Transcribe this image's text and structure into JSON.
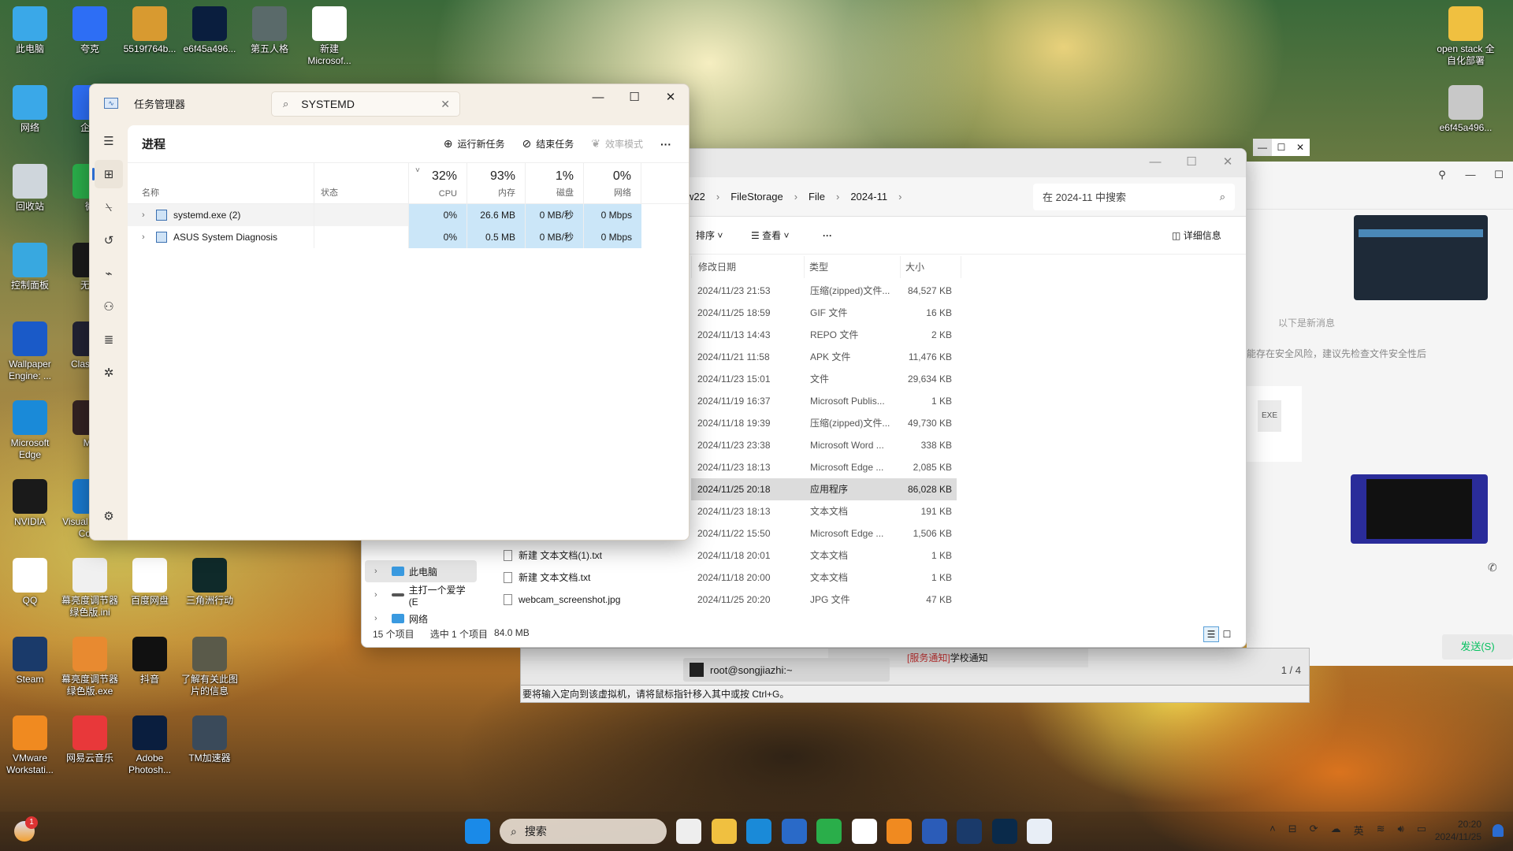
{
  "desktop": {
    "icons": [
      {
        "label": "此电脑",
        "icon": "computer-icon",
        "color": "#3aa8e8"
      },
      {
        "label": "夸克",
        "icon": "quark-icon",
        "color": "#2d6ef5"
      },
      {
        "label": "5519f764b...",
        "icon": "image-file-icon",
        "color": "#d89a30"
      },
      {
        "label": "e6f45a496...",
        "icon": "psd-file-icon",
        "color": "#0a1e3e"
      },
      {
        "label": "第五人格",
        "icon": "game-icon",
        "color": "#5a6a6a"
      },
      {
        "label": "新建 Microsof...",
        "icon": "word-doc-icon",
        "color": "#ffffff"
      },
      {
        "label": "网络",
        "icon": "network-icon",
        "color": "#3aa8e8"
      },
      {
        "label": "企业",
        "icon": "enterprise-icon",
        "color": "#2d6ef5"
      },
      {
        "label": "回收站",
        "icon": "recycle-bin-icon",
        "color": "#cfd6dc"
      },
      {
        "label": "微",
        "icon": "wechat-icon",
        "color": "#2aae4a"
      },
      {
        "label": "控制面板",
        "icon": "control-panel-icon",
        "color": "#38a8e0"
      },
      {
        "label": "无畏",
        "icon": "valorant-icon",
        "color": "#1a1a1a"
      },
      {
        "label": "Wallpaper Engine: ...",
        "icon": "wallpaper-engine-icon",
        "color": "#1a5ac8"
      },
      {
        "label": "Clas Win",
        "icon": "classic-icon",
        "color": "#223"
      },
      {
        "label": "Microsoft Edge",
        "icon": "edge-icon",
        "color": "#1a8ad8"
      },
      {
        "label": "Me",
        "icon": "me-icon",
        "color": "#322"
      },
      {
        "label": "NVIDIA",
        "icon": "nvidia-icon",
        "color": "#1a1a1a"
      },
      {
        "label": "Visual Studio Code",
        "icon": "vscode-icon",
        "color": "#1a7ad0"
      },
      {
        "label": "QQ",
        "icon": "qq-icon",
        "color": "#ffffff"
      },
      {
        "label": "幕亮度调节器绿色版.ini",
        "icon": "ini-file-icon",
        "color": "#f0f0f0"
      },
      {
        "label": "百度网盘",
        "icon": "baidu-netdisk-icon",
        "color": "#ffffff"
      },
      {
        "label": "三角洲行动",
        "icon": "delta-force-icon",
        "color": "#0f2a2a"
      },
      {
        "label": "Steam",
        "icon": "steam-icon",
        "color": "#1a3a6a"
      },
      {
        "label": "幕亮度调节器绿色版.exe",
        "icon": "brightness-app-icon",
        "color": "#e88a30"
      },
      {
        "label": "抖音",
        "icon": "douyin-icon",
        "color": "#111111"
      },
      {
        "label": "了解有关此图片的信息",
        "icon": "spotlight-info-icon",
        "color": "#5a5a4a"
      },
      {
        "label": "VMware Workstati...",
        "icon": "vmware-icon",
        "color": "#f08a20"
      },
      {
        "label": "网易云音乐",
        "icon": "netease-music-icon",
        "color": "#e8383a"
      },
      {
        "label": "Adobe Photosh...",
        "icon": "photoshop-icon",
        "color": "#0a1e3e"
      },
      {
        "label": "TM加速器",
        "icon": "tm-accelerator-icon",
        "color": "#3a4a5a"
      },
      {
        "label": "open stack 全自化部署",
        "icon": "folder-icon",
        "color": "#f0c040"
      },
      {
        "label": "e6f45a496...",
        "icon": "image-file-icon",
        "color": "#c8c8c8"
      }
    ]
  },
  "task_manager": {
    "title": "任务管理器",
    "search_value": "SYSTEMD",
    "page_title": "进程",
    "commands": {
      "run_new_task": "运行新任务",
      "end_task": "结束任务",
      "efficiency_mode": "效率模式",
      "more": "···"
    },
    "columns": {
      "name": "名称",
      "status": "状态",
      "cpu": {
        "pct": "32%",
        "label": "CPU"
      },
      "memory": {
        "pct": "93%",
        "label": "内存"
      },
      "disk": {
        "pct": "1%",
        "label": "磁盘"
      },
      "network": {
        "pct": "0%",
        "label": "网络"
      }
    },
    "rows": [
      {
        "name": "systemd.exe (2)",
        "status": "",
        "cpu": "0%",
        "memory": "26.6 MB",
        "disk": "0 MB/秒",
        "network": "0 Mbps"
      },
      {
        "name": "ASUS System Diagnosis",
        "status": "",
        "cpu": "0%",
        "memory": "0.5 MB",
        "disk": "0 MB/秒",
        "network": "0 Mbps"
      }
    ],
    "nav": [
      "menu-icon",
      "processes-icon",
      "performance-icon",
      "app-history-icon",
      "startup-icon",
      "users-icon",
      "details-icon",
      "services-icon",
      "settings-icon"
    ]
  },
  "explorer": {
    "breadcrumb": [
      "w22",
      "FileStorage",
      "File",
      "2024-11"
    ],
    "search_placeholder": "在 2024-11 中搜索",
    "commands": {
      "sort": "排序",
      "view": "查看",
      "more": "···",
      "details": "详细信息"
    },
    "columns": {
      "date": "修改日期",
      "type": "类型",
      "size": "大小"
    },
    "files": [
      {
        "name": "",
        "date": "2024/11/23 21:53",
        "type": "压缩(zipped)文件...",
        "size": "84,527 KB"
      },
      {
        "name": "",
        "date": "2024/11/25 18:59",
        "type": "GIF 文件",
        "size": "16 KB"
      },
      {
        "name": "",
        "date": "2024/11/13 14:43",
        "type": "REPO 文件",
        "size": "2 KB"
      },
      {
        "name": "",
        "date": "2024/11/21 11:58",
        "type": "APK 文件",
        "size": "11,476 KB"
      },
      {
        "name": "",
        "date": "2024/11/23 15:01",
        "type": "文件",
        "size": "29,634 KB"
      },
      {
        "name": "",
        "date": "2024/11/19 16:37",
        "type": "Microsoft Publis...",
        "size": "1 KB"
      },
      {
        "name": "",
        "date": "2024/11/18 19:39",
        "type": "压缩(zipped)文件...",
        "size": "49,730 KB"
      },
      {
        "name": "",
        "date": "2024/11/23 23:38",
        "type": "Microsoft Word ...",
        "size": "338 KB"
      },
      {
        "name": "",
        "date": "2024/11/23 18:13",
        "type": "Microsoft Edge ...",
        "size": "2,085 KB"
      },
      {
        "name": "",
        "date": "2024/11/25 20:18",
        "type": "应用程序",
        "size": "86,028 KB",
        "selected": true
      },
      {
        "name": "",
        "date": "2024/11/23 18:13",
        "type": "文本文档",
        "size": "191 KB"
      },
      {
        "name": "",
        "date": "2024/11/22 15:50",
        "type": "Microsoft Edge ...",
        "size": "1,506 KB"
      },
      {
        "name": "新建 文本文档(1).txt",
        "date": "2024/11/18 20:01",
        "type": "文本文档",
        "size": "1 KB"
      },
      {
        "name": "新建 文本文档.txt",
        "date": "2024/11/18 20:00",
        "type": "文本文档",
        "size": "1 KB"
      },
      {
        "name": "webcam_screenshot.jpg",
        "date": "2024/11/25 20:20",
        "type": "JPG 文件",
        "size": "47 KB"
      }
    ],
    "nav_pane": [
      {
        "label": "此电脑",
        "icon": "this-pc-icon",
        "selected": true
      },
      {
        "label": "主打一个爱学 (E",
        "icon": "drive-icon"
      },
      {
        "label": "网络",
        "icon": "network-icon"
      }
    ],
    "status": {
      "count": "15 个项目",
      "selected": "选中 1 个项目",
      "size": "84.0 MB"
    }
  },
  "vm": {
    "terminal_tab": "root@songjiazhi:~",
    "notification_tag": "[服务通知]",
    "notification_text": "学校通知",
    "page": "1 / 4",
    "status_hint": "要将输入定向到该虚拟机，请将鼠标指针移入其中或按 Ctrl+G。"
  },
  "chat": {
    "new_messages_divider": "以下是新消息",
    "warning": "能存在安全风险，建议先检查文件安全性后",
    "file_ext": "EXE",
    "send_button": "发送(S)"
  },
  "taskbar": {
    "search_placeholder": "搜索",
    "weather_badge": "1",
    "apps": [
      "start-icon",
      "task-view-icon",
      "file-explorer-icon",
      "edge-icon",
      "store-icon",
      "wechat-icon",
      "qq-icon",
      "vmware-icon",
      "word-icon",
      "steam-icon",
      "app-icon",
      "task-manager-icon"
    ],
    "tray": {
      "ime": "英",
      "time": "20:20",
      "date": "2024/11/25"
    }
  }
}
